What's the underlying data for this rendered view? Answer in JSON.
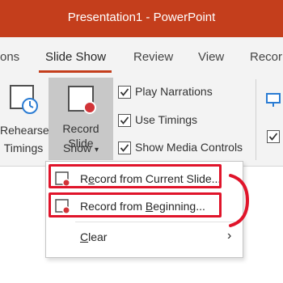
{
  "window": {
    "title": "Presentation1  -  PowerPoint"
  },
  "tabs": [
    {
      "label": "ons"
    },
    {
      "label": "Slide Show"
    },
    {
      "label": "Review"
    },
    {
      "label": "View"
    },
    {
      "label": "Recor"
    }
  ],
  "ribbon": {
    "rehearse": {
      "line1": "Rehearse",
      "line2": "Timings"
    },
    "record": {
      "line1": "Record Slide",
      "line2": "Show",
      "dropdown_glyph": "▾"
    },
    "checkboxes": [
      {
        "label": "Play Narrations",
        "checked": true
      },
      {
        "label": "Use Timings",
        "checked": true
      },
      {
        "label": "Show Media Controls",
        "checked": true
      }
    ]
  },
  "menu": {
    "items": [
      {
        "pre": "R",
        "accel": "e",
        "post": "cord from Current Slide...",
        "icon": "record-slide-icon"
      },
      {
        "pre": "Record from ",
        "accel": "B",
        "post": "eginning...",
        "icon": "record-slide-icon"
      },
      {
        "pre": "",
        "accel": "C",
        "post": "lear",
        "submenu_glyph": "›"
      }
    ]
  },
  "annotation": {
    "color": "#e0142a"
  },
  "colors": {
    "accent": "#c43e1c",
    "ribbon": "#f3f3f3",
    "record_dot": "#d13438"
  }
}
